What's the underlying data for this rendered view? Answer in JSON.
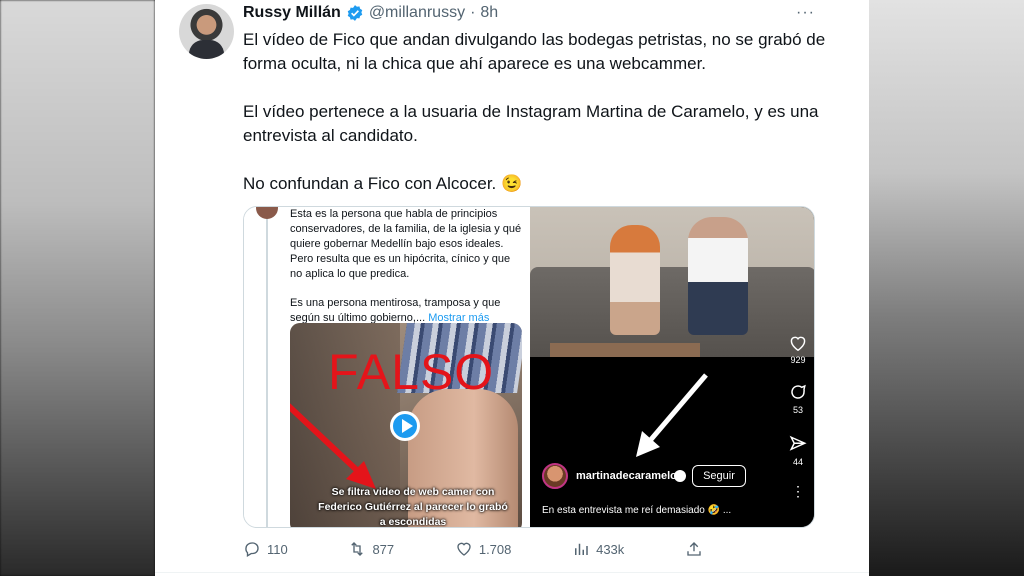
{
  "tweet": {
    "name": "Russy Millán",
    "handle": "@millanrussy",
    "time": "8h",
    "more": "···",
    "paragraphs": [
      "El vídeo de Fico que andan divulgando las bodegas petristas, no se grabó de forma oculta, ni la chica que ahí aparece es una webcammer.",
      "El vídeo pertenece a la usuaria de Instagram Martina de Caramelo, y es una entrevista al candidato.",
      "No confundan a Fico con Alcocer. 😉"
    ]
  },
  "embedded_left": {
    "text1": "Esta es la persona que habla de principios conservadores, de la familia, de la iglesia y qué quiere gobernar Medellín bajo esos ideales. Pero resulta que es un hipócrita, cínico y que no aplica lo que predica.",
    "text2": "Es una persona mentirosa, tramposa y que según su último gobierno,...",
    "show_more": "Mostrar más",
    "overlay": "FALSO",
    "caption": "Se filtra video de web camer con Federico Gutiérrez al parecer lo grabó a escondidas"
  },
  "embedded_right": {
    "username": "martinadecaramelo",
    "follow": "Seguir",
    "caption": "En esta entrevista me reí demasiado 🤣 ...",
    "likes": "929",
    "comments": "53",
    "shares": "44",
    "more": "⋮"
  },
  "actions": {
    "replies": "110",
    "retweets": "877",
    "likes": "1.708",
    "views": "433k"
  },
  "colors": {
    "accent": "#1d9bf0",
    "text": "#0f1419",
    "secondary": "#536471",
    "falso_red": "#e4141a"
  }
}
